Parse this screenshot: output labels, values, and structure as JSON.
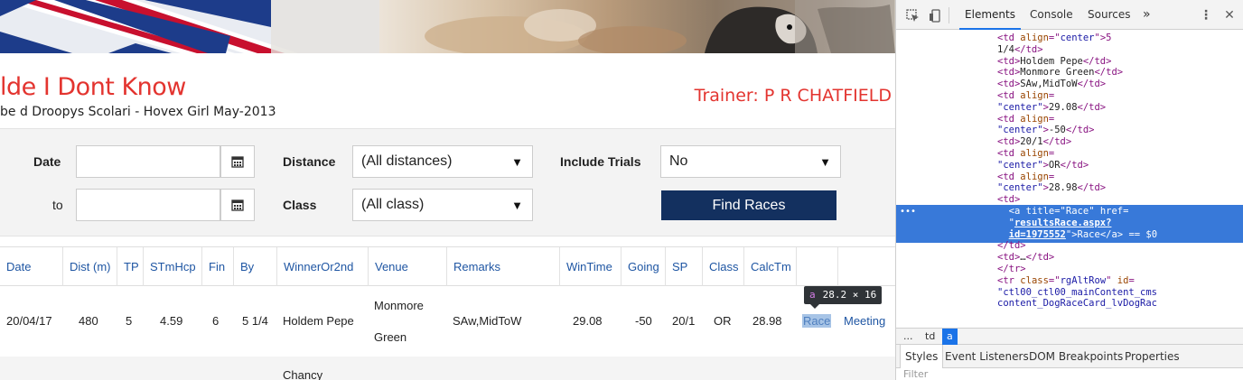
{
  "page": {
    "dog_name": "lde I Dont Know",
    "breeding": "be d Droopys Scolari - Hovex Girl May-2013",
    "trainer": "Trainer: P R CHATFIELD"
  },
  "filters": {
    "date_label": "Date",
    "to_label": "to",
    "date_value": "",
    "to_value": "",
    "distance_label": "Distance",
    "distance_value": "(All distances)",
    "class_label": "Class",
    "class_value": "(All class)",
    "trials_label": "Include Trials",
    "trials_value": "No",
    "find_button": "Find Races"
  },
  "table": {
    "headers": [
      "Date",
      "Dist (m)",
      "TP",
      "STmHcp",
      "Fin",
      "By",
      "WinnerOr2nd",
      "Venue",
      "Remarks",
      "WinTime",
      "Going",
      "SP",
      "Class",
      "CalcTm",
      "",
      ""
    ],
    "row1": {
      "date": "20/04/17",
      "dist": "480",
      "tp": "5",
      "stmhcp": "4.59",
      "fin": "6",
      "by": "5 1/4",
      "winner": "Holdem Pepe",
      "venue_line1": "Monmore",
      "venue_line2": "Green",
      "remarks": "SAw,MidToW",
      "wintime": "29.08",
      "going": "-50",
      "sp": "20/1",
      "class": "OR",
      "calctm": "28.98",
      "race_link": "Race",
      "meeting_link": "Meeting"
    },
    "row2": {
      "winner_partial": "Chancy"
    }
  },
  "tooltip": {
    "tag": "a",
    "size": "28.2 × 16"
  },
  "devtools": {
    "tabs": [
      "Elements",
      "Console",
      "Sources"
    ],
    "more": "»",
    "dom_lines": [
      {
        "indent": "        ",
        "parts": [
          [
            "<td ",
            "p"
          ],
          [
            "align",
            "a"
          ],
          [
            "=\"",
            "p"
          ],
          [
            "center",
            "v"
          ],
          [
            "\">5",
            "p"
          ]
        ]
      },
      {
        "indent": "        ",
        "parts": [
          [
            "1/4",
            "t"
          ],
          [
            "</td>",
            "p"
          ]
        ]
      },
      {
        "indent": "        ",
        "parts": [
          [
            "<td>",
            "p"
          ],
          [
            "Holdem Pepe",
            "t"
          ],
          [
            "</td>",
            "p"
          ]
        ]
      },
      {
        "indent": "        ",
        "parts": [
          [
            "<td>",
            "p"
          ],
          [
            "Monmore Green",
            "t"
          ],
          [
            "</td>",
            "p"
          ]
        ]
      },
      {
        "indent": "        ",
        "parts": [
          [
            "<td>",
            "p"
          ],
          [
            "SAw,MidToW",
            "t"
          ],
          [
            "</td>",
            "p"
          ]
        ]
      },
      {
        "indent": "        ",
        "parts": [
          [
            "<td ",
            "p"
          ],
          [
            "align",
            "a"
          ],
          [
            "=",
            "p"
          ]
        ]
      },
      {
        "indent": "        ",
        "parts": [
          [
            "\"center\"",
            "v"
          ],
          [
            ">",
            "p"
          ],
          [
            "29.08",
            "t"
          ],
          [
            "</td>",
            "p"
          ]
        ]
      },
      {
        "indent": "        ",
        "parts": [
          [
            "<td ",
            "p"
          ],
          [
            "align",
            "a"
          ],
          [
            "=",
            "p"
          ]
        ]
      },
      {
        "indent": "        ",
        "parts": [
          [
            "\"center\"",
            "v"
          ],
          [
            ">",
            "p"
          ],
          [
            "-50",
            "t"
          ],
          [
            "</td>",
            "p"
          ]
        ]
      },
      {
        "indent": "        ",
        "parts": [
          [
            "<td>",
            "p"
          ],
          [
            "20/1",
            "t"
          ],
          [
            "</td>",
            "p"
          ]
        ]
      },
      {
        "indent": "        ",
        "parts": [
          [
            "<td ",
            "p"
          ],
          [
            "align",
            "a"
          ],
          [
            "=",
            "p"
          ]
        ]
      },
      {
        "indent": "        ",
        "parts": [
          [
            "\"center\"",
            "v"
          ],
          [
            ">",
            "p"
          ],
          [
            "OR",
            "t"
          ],
          [
            "</td>",
            "p"
          ]
        ]
      },
      {
        "indent": "        ",
        "parts": [
          [
            "<td ",
            "p"
          ],
          [
            "align",
            "a"
          ],
          [
            "=",
            "p"
          ]
        ]
      },
      {
        "indent": "        ",
        "parts": [
          [
            "\"center\"",
            "v"
          ],
          [
            ">",
            "p"
          ],
          [
            "28.98",
            "t"
          ],
          [
            "</td>",
            "p"
          ]
        ]
      },
      {
        "indent": "      ▼ ",
        "parts": [
          [
            "<td>",
            "p"
          ]
        ]
      },
      {
        "indent": "          ",
        "parts": [
          [
            "<a ",
            "p"
          ],
          [
            "title",
            "a"
          ],
          [
            "=\"",
            "p"
          ],
          [
            "Race",
            "v"
          ],
          [
            "\" ",
            "p"
          ],
          [
            "href",
            "a"
          ],
          [
            "=",
            "p"
          ]
        ],
        "selected": true
      },
      {
        "indent": "          ",
        "parts": [
          [
            "\"",
            "p"
          ],
          [
            "resultsRace.aspx?",
            "u"
          ]
        ],
        "selected": true
      },
      {
        "indent": "          ",
        "parts": [
          [
            "id=1975552",
            "u"
          ],
          [
            "\">",
            "p"
          ],
          [
            "Race",
            "t"
          ],
          [
            "</a>",
            "p"
          ],
          [
            " == $0",
            "t"
          ]
        ],
        "selected": true
      },
      {
        "indent": "        ",
        "parts": [
          [
            "</td>",
            "p"
          ]
        ]
      },
      {
        "indent": "      ▶ ",
        "parts": [
          [
            "<td>",
            "p"
          ],
          [
            "…",
            "t"
          ],
          [
            "</td>",
            "p"
          ]
        ]
      },
      {
        "indent": "      ",
        "parts": [
          [
            "</tr>",
            "p"
          ]
        ]
      },
      {
        "indent": "    ▶ ",
        "parts": [
          [
            "<tr ",
            "p"
          ],
          [
            "class",
            "a"
          ],
          [
            "=\"",
            "p"
          ],
          [
            "rgAltRow",
            "v"
          ],
          [
            "\" ",
            "p"
          ],
          [
            "id",
            "a"
          ],
          [
            "=",
            "p"
          ]
        ]
      },
      {
        "indent": "      ",
        "parts": [
          [
            "\"ctl00_ctl00_mainContent_cms",
            "v"
          ]
        ]
      },
      {
        "indent": "      ",
        "parts": [
          [
            "content_DogRaceCard_lvDogRac",
            "v"
          ]
        ]
      }
    ],
    "breadcrumbs": [
      "...",
      "td",
      "a"
    ],
    "subtabs": [
      "Styles",
      "Event Listeners",
      "DOM Breakpoints",
      "Properties"
    ],
    "filter_placeholder": "Filter"
  }
}
